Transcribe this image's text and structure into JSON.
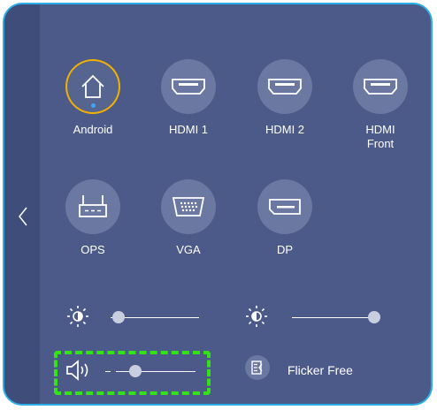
{
  "sources": [
    {
      "label": "Android",
      "icon": "home-icon",
      "active": true
    },
    {
      "label": "HDMI 1",
      "icon": "hdmi-icon"
    },
    {
      "label": "HDMI 2",
      "icon": "hdmi-icon"
    },
    {
      "label": "HDMI\nFront",
      "icon": "hdmi-icon"
    },
    {
      "label": "OPS",
      "icon": "router-icon"
    },
    {
      "label": "VGA",
      "icon": "vga-icon"
    },
    {
      "label": "DP",
      "icon": "displayport-icon"
    }
  ],
  "sliders": {
    "backlight": {
      "icon": "brightness-icon",
      "level": 0.02
    },
    "contrast": {
      "icon": "contrast-icon",
      "level": 1.0
    },
    "volume": {
      "icon": "volume-icon",
      "level": 0.2
    }
  },
  "flicker_free": {
    "label": "Flicker Free",
    "icon": "flicker-free-icon"
  },
  "colors": {
    "panel": "#4b5a88",
    "border": "#29aee6",
    "active_ring": "#f2b000",
    "highlight": "#34e218"
  }
}
